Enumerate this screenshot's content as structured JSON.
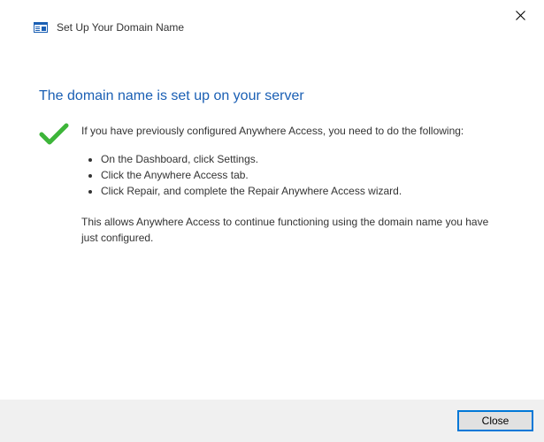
{
  "header": {
    "title": "Set Up Your Domain Name"
  },
  "main": {
    "heading": "The domain name is set up on your server",
    "intro": "If you have previously configured Anywhere Access, you need to do the following:",
    "steps": [
      "On the Dashboard, click Settings.",
      "Click the Anywhere Access  tab.",
      "Click Repair, and complete the Repair Anywhere Access wizard."
    ],
    "outro": "This allows Anywhere Access to continue functioning using the domain name you have just configured."
  },
  "footer": {
    "close_label": "Close"
  }
}
